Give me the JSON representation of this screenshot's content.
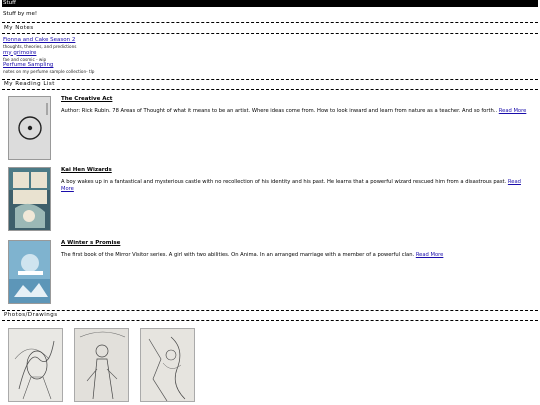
{
  "header": {
    "title": "Stuff",
    "subtitle": "Stuff by me!"
  },
  "notes": {
    "title": "My Notes",
    "items": [
      {
        "link": "Fionna and Cake Season 2",
        "desc": "thoughts, theories, and predictions"
      },
      {
        "link": "my grimoire",
        "desc": "fae and cosmic - wip"
      },
      {
        "link": "Perfume Sampling",
        "desc": "notes on my perfume sample collection- tlp"
      }
    ]
  },
  "reading": {
    "title": "My Reading List",
    "read_more": "Read More",
    "books": [
      {
        "title": "The Creative Act",
        "desc": "Author: Rick Rubin. 78 Areas of Thought of what it means to be an artist. Where ideas come from. How to look inward and learn from nature as a teacher. And so forth.."
      },
      {
        "title": "Kai Hen Wizards",
        "desc": "A boy wakes up in a fantastical and mysterious castle with no recollection of his identity and his past. He learns that a powerful wizard rescued him from a disastrous past."
      },
      {
        "title": "A Winter s Promise",
        "desc": "The first book of the Mirror Visitor series. A girl with two abilities. On Anima. In an arranged marriage with a member of a powerful clan."
      }
    ]
  },
  "photos": {
    "title": "Photos/Drawings"
  },
  "colors": {
    "link": "#1a0dab",
    "topbar": "#000000"
  },
  "icons": [
    "circle-cover-art",
    "manga-cover-art",
    "winter-cover-art",
    "drawing-sketch"
  ]
}
